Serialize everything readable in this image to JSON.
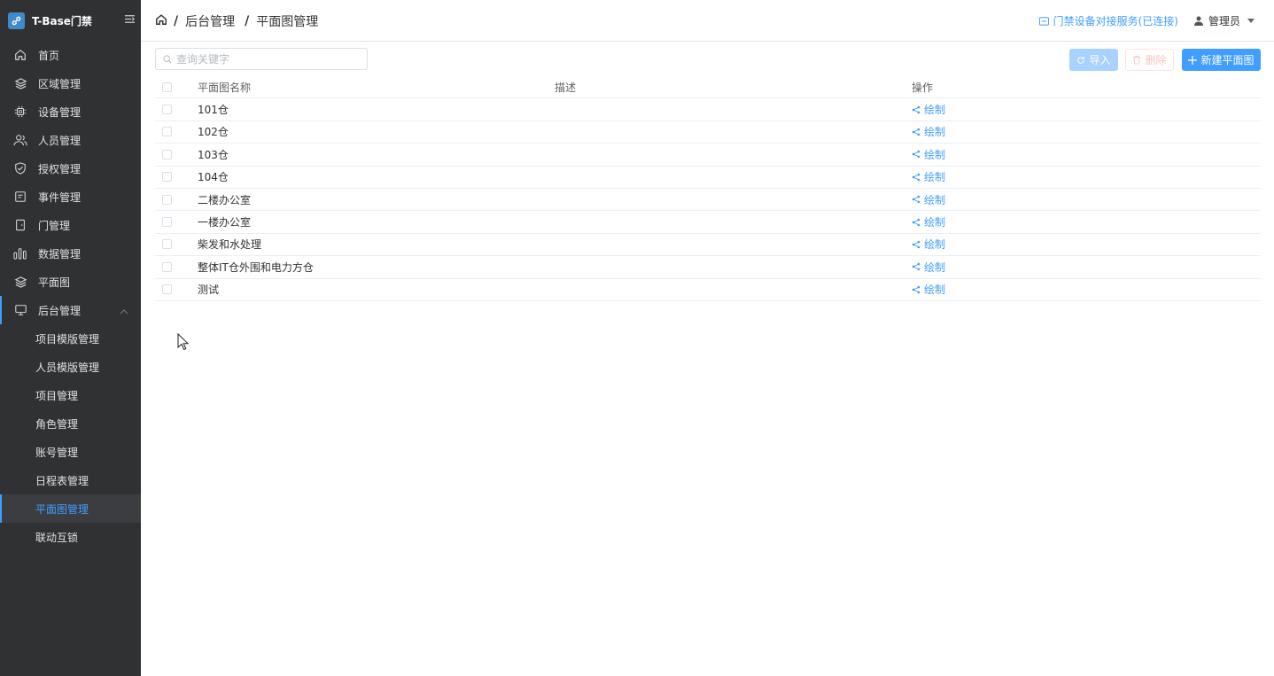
{
  "sidebar": {
    "brand": "T-Base门禁",
    "items": [
      {
        "label": "首页",
        "icon": "home-icon"
      },
      {
        "label": "区域管理",
        "icon": "layers-icon"
      },
      {
        "label": "设备管理",
        "icon": "chip-icon"
      },
      {
        "label": "人员管理",
        "icon": "users-icon"
      },
      {
        "label": "授权管理",
        "icon": "shield-check-icon"
      },
      {
        "label": "事件管理",
        "icon": "document-icon"
      },
      {
        "label": "门管理",
        "icon": "door-icon"
      },
      {
        "label": "数据管理",
        "icon": "bar-chart-icon"
      },
      {
        "label": "平面图",
        "icon": "layers-icon"
      },
      {
        "label": "后台管理",
        "icon": "monitor-icon"
      }
    ],
    "sub_items": [
      {
        "label": "项目模版管理"
      },
      {
        "label": "人员模版管理"
      },
      {
        "label": "项目管理"
      },
      {
        "label": "角色管理"
      },
      {
        "label": "账号管理"
      },
      {
        "label": "日程表管理"
      },
      {
        "label": "平面图管理",
        "active": true
      },
      {
        "label": "联动互锁"
      }
    ]
  },
  "header": {
    "breadcrumb": [
      "后台管理",
      "平面图管理"
    ],
    "status": "门禁设备对接服务(已连接)",
    "user": "管理员"
  },
  "toolbar": {
    "search_placeholder": "查询关键字",
    "import_label": "导入",
    "delete_label": "删除",
    "new_label": "新建平面图"
  },
  "table": {
    "columns": [
      "平面图名称",
      "描述",
      "操作"
    ],
    "action_label": "绘制",
    "rows": [
      {
        "name": "101仓",
        "desc": ""
      },
      {
        "name": "102仓",
        "desc": ""
      },
      {
        "name": "103仓",
        "desc": ""
      },
      {
        "name": "104仓",
        "desc": ""
      },
      {
        "name": "二楼办公室",
        "desc": ""
      },
      {
        "name": "一楼办公室",
        "desc": ""
      },
      {
        "name": "柴发和水处理",
        "desc": ""
      },
      {
        "name": "整体IT仓外围和电力方仓",
        "desc": ""
      },
      {
        "name": "测试",
        "desc": ""
      }
    ]
  },
  "colors": {
    "sidebar_bg": "#303133",
    "accent": "#409eff",
    "active_bg": "#3c3d40"
  }
}
